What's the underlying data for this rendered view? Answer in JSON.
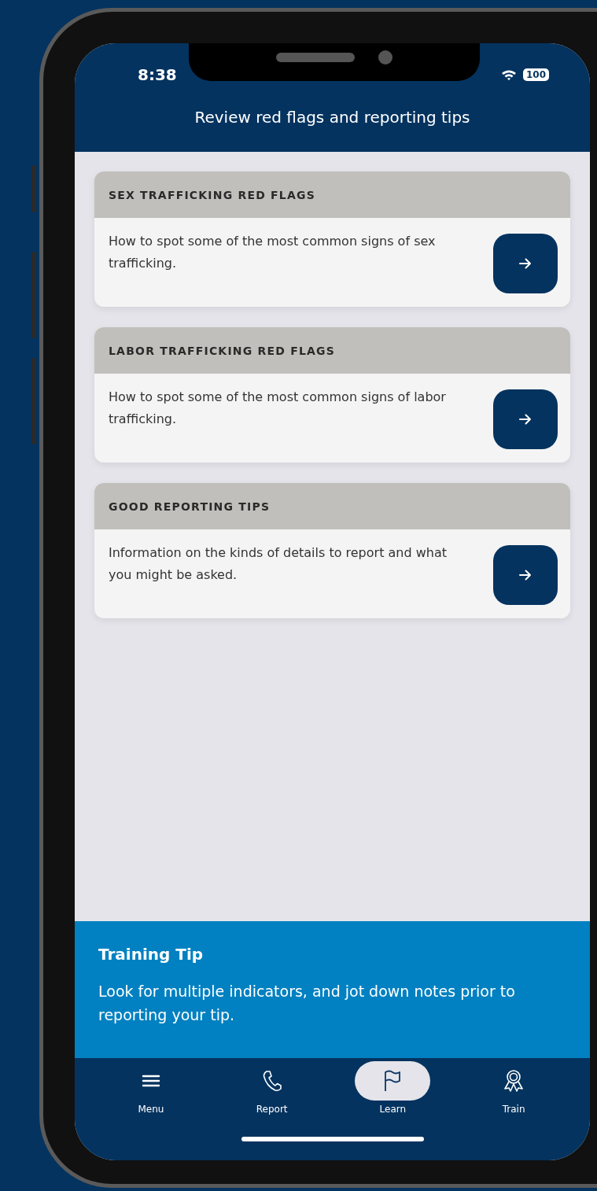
{
  "status_bar": {
    "time": "8:38",
    "battery": "100"
  },
  "header": {
    "title": "Review red flags and reporting tips"
  },
  "cards": [
    {
      "title": "SEX TRAFFICKING RED FLAGS",
      "description": "How to spot some of the most common signs of sex trafficking."
    },
    {
      "title": "LABOR TRAFFICKING RED FLAGS",
      "description": "How to spot some of the most common signs of labor trafficking."
    },
    {
      "title": "GOOD REPORTING TIPS",
      "description": "Information on the kinds of details to report and what you might be asked."
    }
  ],
  "training_tip": {
    "title": "Training Tip",
    "text": "Look for multiple indicators, and jot down notes prior to reporting your tip."
  },
  "tab_bar": [
    {
      "kind": "menu",
      "label": "Menu",
      "selected": false
    },
    {
      "kind": "phone",
      "label": "Report",
      "selected": false
    },
    {
      "kind": "flag",
      "label": "Learn",
      "selected": true
    },
    {
      "kind": "ribbon",
      "label": "Train",
      "selected": false
    }
  ]
}
